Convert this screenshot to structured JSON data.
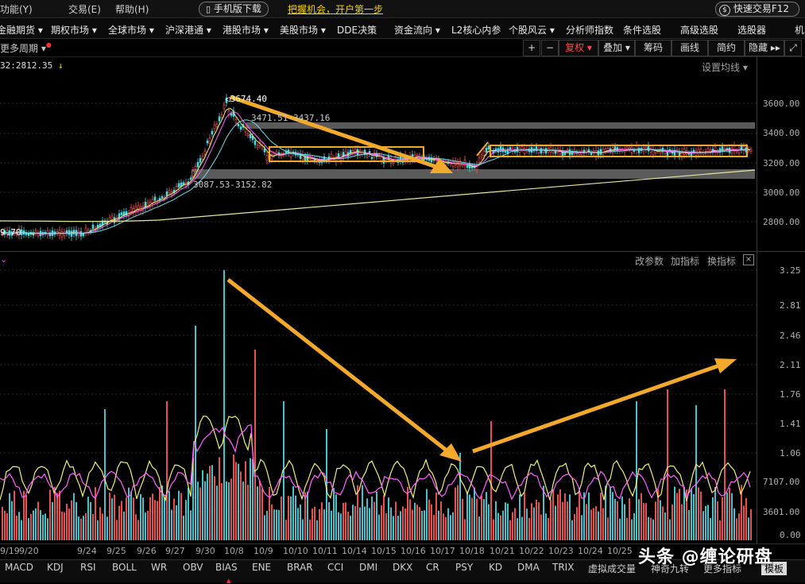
{
  "topbar": {
    "menu": [
      "功能(Y)",
      "交易(E)",
      "帮助(H)"
    ],
    "mobile_download": "手机版下载",
    "promo": "把握机会，开户第一步",
    "quick_trade": "快速交易F12"
  },
  "nav": [
    "金融期货",
    "期权市场",
    "全球市场",
    "沪深港通",
    "港股市场",
    "美股市场",
    "DDE决策",
    "资金流向",
    "L2核心内参",
    "个股风云",
    "分析师指数",
    "条件选股",
    "高级选股",
    "选股器",
    "机"
  ],
  "toolbar": {
    "period": "更多周期",
    "plus": "+",
    "minus": "−",
    "fuquan": "复权",
    "overlay": "叠加",
    "chips": "筹码",
    "draw": "画线",
    "simple": "简约",
    "hide": "隐藏",
    "ma_info": "32:2812.35",
    "ma_settings": "设置均线"
  },
  "upper": {
    "price_axis": [
      "3600.00",
      "3400.00",
      "3200.00",
      "3000.00",
      "2800.00"
    ],
    "notes": {
      "peak": "3674.40",
      "upper_band": "3471.51-3437.16",
      "lower_band": "3087.53-3152.82",
      "left_low": "9.70"
    }
  },
  "lower": {
    "controls": {
      "change_param": "改参数",
      "add_indicator": "加指标",
      "switch_indicator": "换指标"
    },
    "axis": [
      "3.25",
      "2.81",
      "2.46",
      "2.11",
      "1.76",
      "1.41",
      "1.06",
      "7107.00",
      "3601.00",
      "0.00"
    ]
  },
  "dates": [
    "9/19",
    "9/20",
    "9/24",
    "9/25",
    "9/26",
    "9/27",
    "9/30",
    "10/8",
    "10/9",
    "10/10",
    "10/11",
    "10/14",
    "10/15",
    "10/16",
    "10/17",
    "10/18",
    "10/21",
    "10/22",
    "10/23",
    "10/24",
    "10/25"
  ],
  "tabs": [
    "MACD",
    "KDJ",
    "RSI",
    "BOLL",
    "WR",
    "OBV",
    "BIAS",
    "ENE",
    "BRAR",
    "CCI",
    "DMI",
    "DKX",
    "CR",
    "PSY",
    "KD",
    "DMA",
    "TRIX",
    "虚拟成交量",
    "神奇九转",
    "更多指标",
    "模板"
  ],
  "watermark": "头条 @缠论研盘",
  "colors": {
    "up": "#ff5a5a",
    "down": "#4fd6e0",
    "highlight": "#f2a92c",
    "ma5": "#f0f07a",
    "ma10": "#ff66ff",
    "ma20": "#6fe0e8",
    "ma60": "#e6e6a0",
    "promo": "#f2d200"
  }
}
